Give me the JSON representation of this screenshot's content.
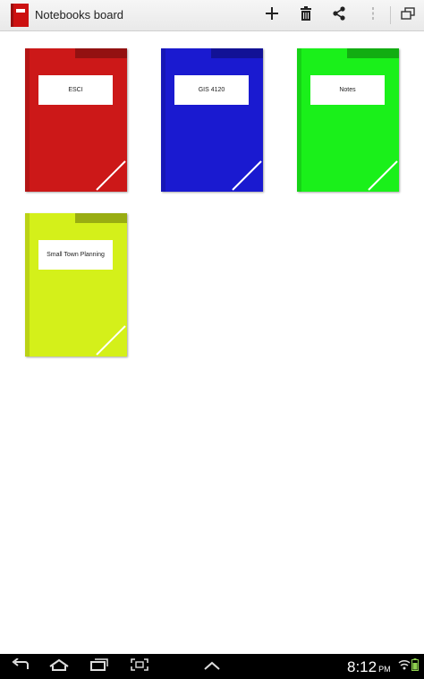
{
  "app": {
    "title": "Notebooks board",
    "icon": "notebook-app-icon",
    "accent_color": "#cc1111"
  },
  "actionbar": {
    "actions": [
      {
        "name": "add",
        "icon": "plus-icon"
      },
      {
        "name": "delete",
        "icon": "trash-icon"
      },
      {
        "name": "share",
        "icon": "share-icon"
      },
      {
        "name": "overflow",
        "icon": "more-vertical-icon",
        "disabled": true
      },
      {
        "name": "window",
        "icon": "multi-window-icon"
      }
    ]
  },
  "notebooks": [
    {
      "label": "ESCI",
      "color": "#cc1818"
    },
    {
      "label": "GIS 4120",
      "color": "#1a1ad0"
    },
    {
      "label": "Notes",
      "color": "#1af01a"
    },
    {
      "label": "Small Town Planning",
      "color": "#d4f01a"
    }
  ],
  "statusbar": {
    "time": "8:12",
    "ampm": "PM",
    "icons": [
      "back-icon",
      "home-icon",
      "recent-apps-icon",
      "screenshot-icon",
      "up-caret-icon",
      "wifi-icon",
      "battery-icon"
    ]
  }
}
